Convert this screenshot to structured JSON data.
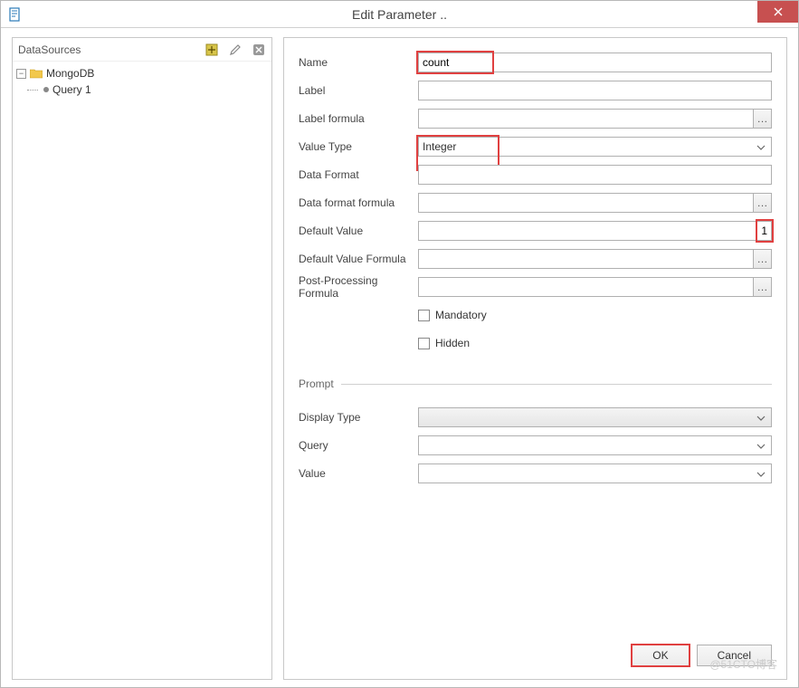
{
  "titlebar": {
    "title": "Edit Parameter .."
  },
  "sidebar": {
    "title": "DataSources",
    "tree": {
      "root_label": "MongoDB",
      "child_label": "Query 1"
    }
  },
  "form": {
    "name": {
      "label": "Name",
      "value": "count"
    },
    "label": {
      "label": "Label",
      "value": ""
    },
    "label_formula": {
      "label": "Label formula",
      "value": ""
    },
    "value_type": {
      "label": "Value Type",
      "value": "Integer"
    },
    "data_format": {
      "label": "Data Format",
      "value": ""
    },
    "data_format_formula": {
      "label": "Data format formula",
      "value": ""
    },
    "default_value": {
      "label": "Default Value",
      "value": "1"
    },
    "default_value_formula": {
      "label": "Default Value Formula",
      "value": ""
    },
    "post_processing_formula": {
      "label": "Post-Processing Formula",
      "value": ""
    },
    "mandatory": {
      "label": "Mandatory"
    },
    "hidden": {
      "label": "Hidden"
    }
  },
  "prompt": {
    "section_label": "Prompt",
    "display_type": {
      "label": "Display Type",
      "value": ""
    },
    "query": {
      "label": "Query",
      "value": ""
    },
    "value": {
      "label": "Value",
      "value": ""
    }
  },
  "buttons": {
    "ok": "OK",
    "cancel": "Cancel"
  },
  "watermark": "@51CTO博客"
}
